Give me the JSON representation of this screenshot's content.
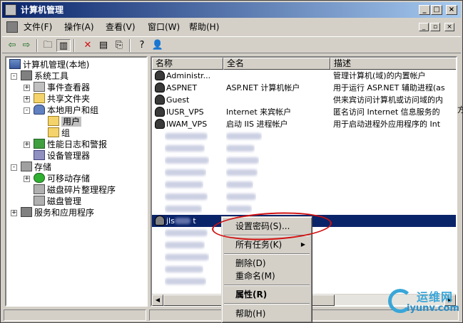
{
  "window": {
    "title": "计算机管理",
    "buttons": {
      "minimize": "_",
      "maximize": "□",
      "close": "×"
    }
  },
  "menubar": {
    "items": [
      "文件(F)",
      "操作(A)",
      "查看(V)",
      "窗口(W)",
      "帮助(H)"
    ],
    "mdi_buttons": {
      "minimize": "_",
      "restore": "▫",
      "close": "×"
    }
  },
  "toolbar": {
    "icons": [
      "back-arrow-icon",
      "forward-arrow-icon",
      "up-folder-icon",
      "show-tree-icon",
      "delete-icon",
      "properties-icon",
      "export-icon",
      "help-icon",
      "new-user-icon"
    ]
  },
  "tree": {
    "root": "计算机管理(本地)",
    "items": [
      {
        "label": "系统工具",
        "expander": "-"
      },
      {
        "label": "事件查看器",
        "expander": "+"
      },
      {
        "label": "共享文件夹",
        "expander": "+"
      },
      {
        "label": "本地用户和组",
        "expander": "-"
      },
      {
        "label": "用户",
        "expander": ""
      },
      {
        "label": "组",
        "expander": ""
      },
      {
        "label": "性能日志和警报",
        "expander": "+"
      },
      {
        "label": "设备管理器",
        "expander": ""
      },
      {
        "label": "存储",
        "expander": "-"
      },
      {
        "label": "可移动存储",
        "expander": "+"
      },
      {
        "label": "磁盘碎片整理程序",
        "expander": ""
      },
      {
        "label": "磁盘管理",
        "expander": ""
      },
      {
        "label": "服务和应用程序",
        "expander": "+"
      }
    ]
  },
  "list": {
    "columns": [
      "名称",
      "全名",
      "描述"
    ],
    "rows": [
      {
        "name": "Administr...",
        "fullname": "",
        "desc": "管理计算机(域)的内置帐户"
      },
      {
        "name": "ASPNET",
        "fullname": "ASP.NET 计算机帐户",
        "desc": "用于运行 ASP.NET 辅助进程(as"
      },
      {
        "name": "Guest",
        "fullname": "",
        "desc": "供来宾访问计算机或访问域的内"
      },
      {
        "name": "IUSR_VPS",
        "fullname": "Internet 来宾帐户",
        "desc": "匿名访问 Internet 信息服务的"
      },
      {
        "name": "IWAM_VPS",
        "fullname": "启动 IIS 进程帐户",
        "desc": "用于启动进程外应用程序的 Int"
      }
    ],
    "selected_row": {
      "name": "jls",
      "suffix": "t"
    }
  },
  "context_menu": {
    "items": [
      "设置密码(S)...",
      "所有任务(K)",
      "删除(D)",
      "重命名(M)",
      "属性(R)",
      "帮助(H)"
    ],
    "submenu_arrow": "▶"
  },
  "right_edge_text": "方",
  "watermark": {
    "line1": "运维网",
    "line2": "iyunv.com"
  },
  "colors": {
    "title_start": "#0a246a",
    "title_end": "#a6caf0",
    "selection": "#0a246a",
    "highlight_ring": "#d01010"
  }
}
